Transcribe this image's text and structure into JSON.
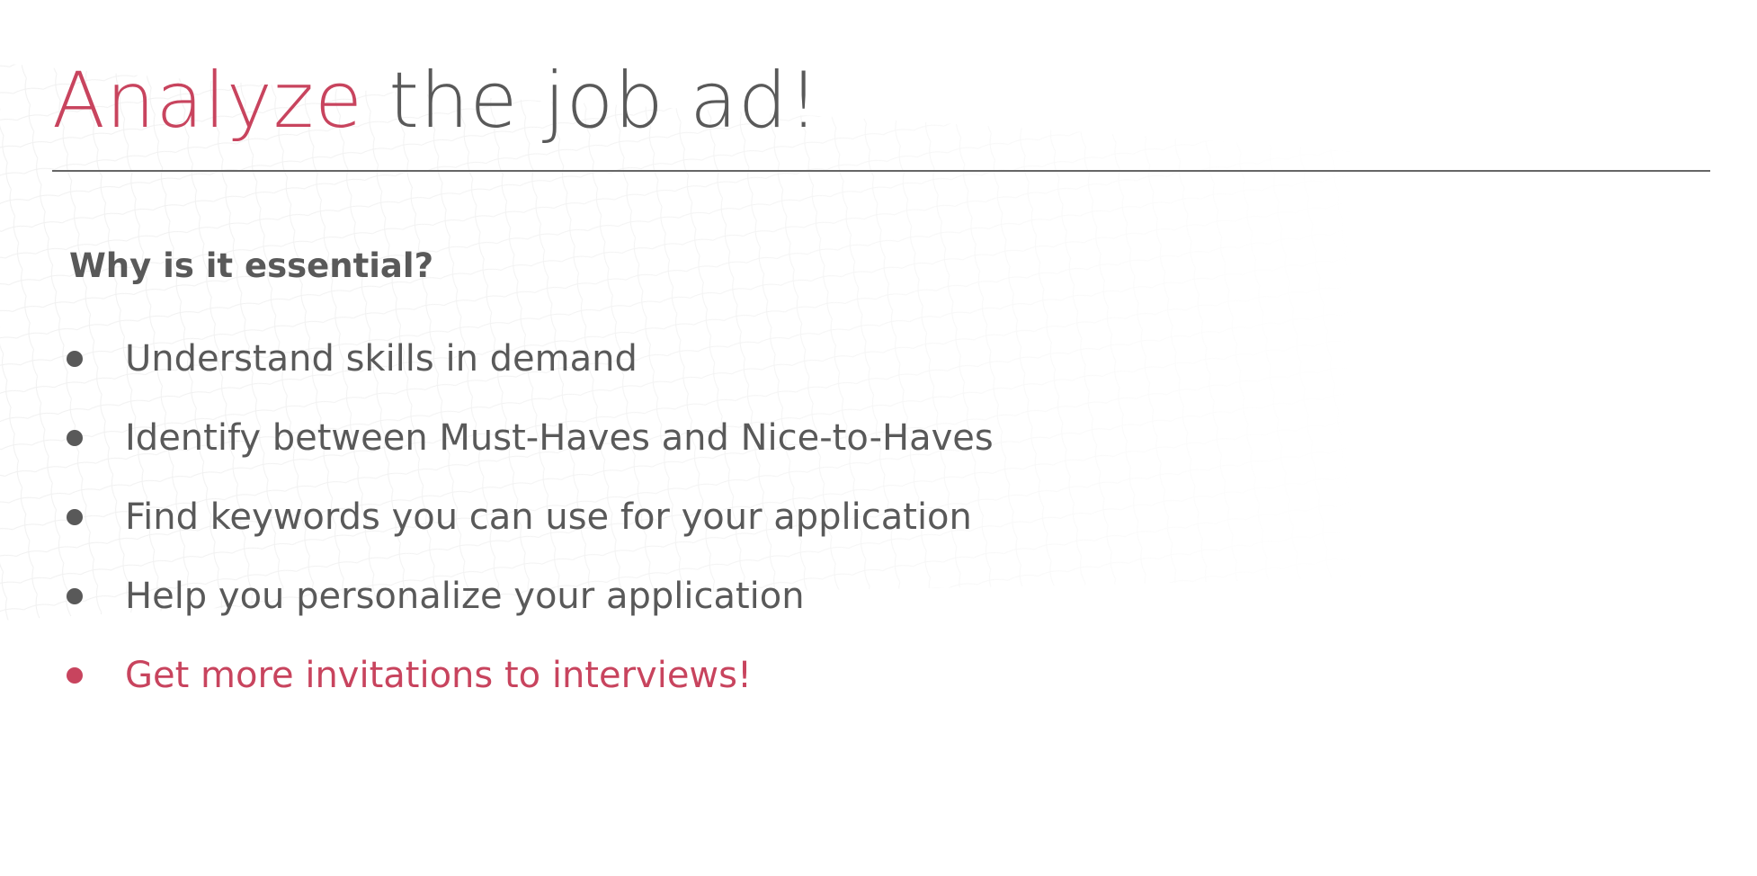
{
  "slide": {
    "title_accent": "Analyze",
    "title_rest": "the job ad!",
    "subheading": "Why is it essential?",
    "bullets": [
      "Understand skills in demand",
      "Identify between Must-Haves and Nice-to-Haves",
      "Find keywords you can use for your application",
      "Help you personalize your application",
      "Get more invitations to interviews!"
    ]
  },
  "colors": {
    "accent": "#c8445e",
    "text": "#595959",
    "rule": "#666666",
    "background": "#ffffff"
  }
}
